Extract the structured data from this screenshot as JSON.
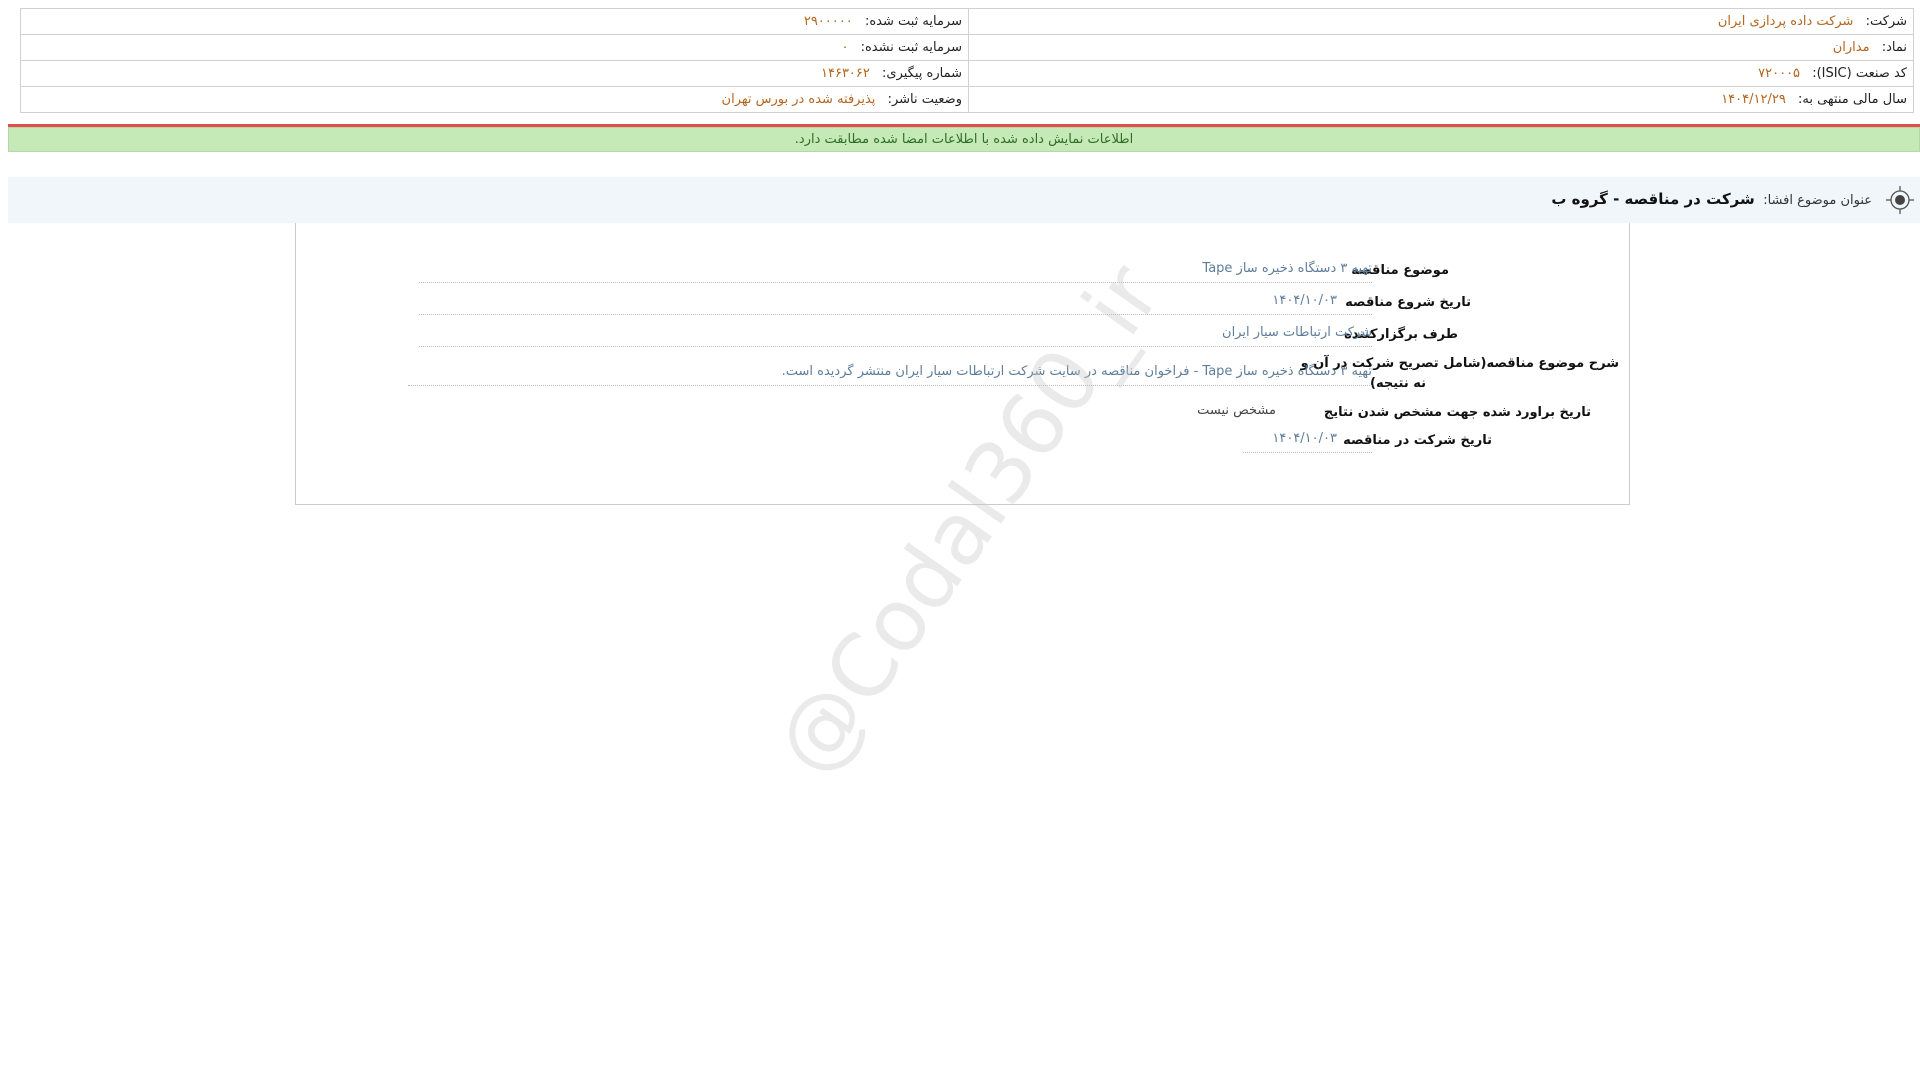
{
  "company_info": {
    "company_label": "شرکت:",
    "company_value": "شرکت داده پردازی ایران",
    "registered_capital_label": "سرمایه ثبت شده:",
    "registered_capital_value": "۲۹۰۰۰۰۰",
    "symbol_label": "نماد:",
    "symbol_value": "مداران",
    "unregistered_capital_label": "سرمایه ثبت نشده:",
    "unregistered_capital_value": "۰",
    "isic_label": "کد صنعت (ISIC):",
    "isic_value": "۷۲۰۰۰۵",
    "tracking_label": "شماره پیگیری:",
    "tracking_value": "۱۴۶۳۰۶۲",
    "fiscal_year_label": "سال مالی منتهی به:",
    "fiscal_year_value": "۱۴۰۴/۱۲/۲۹",
    "publisher_status_label": "وضعیت ناشر:",
    "publisher_status_value": "پذیرفته شده در بورس تهران"
  },
  "verification_notice": "اطلاعات نمایش داده شده با اطلاعات امضا شده مطابقت دارد.",
  "disclosure": {
    "title_label": "عنوان موضوع افشا:",
    "title_value": "شرکت در مناقصه - گروه ب",
    "icon": "target-icon"
  },
  "tender": {
    "subject_label": "موضوع مناقصه",
    "subject_value": "تهیه ۳ دستگاه ذخیره ساز Tape",
    "start_date_label": "تاریخ شروع مناقصه",
    "start_date_value": "۱۴۰۴/۱۰/۰۳",
    "organizer_label": "طرف برگزارکننده",
    "organizer_value": "شرکت ارتباطات سیار ایران",
    "description_label_line1": "شرح موضوع مناقصه(شامل تصریح شرکت در آن و",
    "description_label_line2": "نه نتیجه)",
    "description_value": "تهیه ۳ دستگاه ذخیره ساز Tape - فراخوان مناقصه در سایت شرکت ارتباطات سیار ایران منتشر گردیده است.",
    "estimated_result_date_label": "تاریخ براورد شده جهت مشخص شدن نتایج",
    "estimated_result_date_value": "مشخص نیست",
    "participation_date_label": "تاریخ شرکت در مناقصه",
    "participation_date_value": "۱۴۰۴/۱۰/۰۳"
  },
  "watermark": "@Codal360_ir",
  "colors": {
    "value_orange": "#b5651d",
    "notice_green_bg": "#c6e9b8",
    "notice_green_text": "#2e6e23",
    "accent_red": "#e05050",
    "tender_value_blue": "#5f7d9a"
  }
}
